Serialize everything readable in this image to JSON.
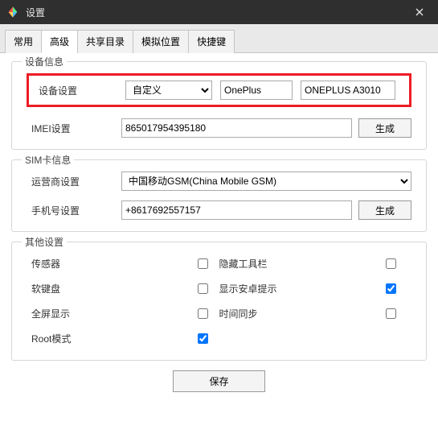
{
  "titlebar": {
    "title": "设置"
  },
  "tabs": [
    "常用",
    "高级",
    "共享目录",
    "模拟位置",
    "快捷键"
  ],
  "activeTab": 1,
  "deviceInfo": {
    "title": "设备信息",
    "deviceLabel": "设备设置",
    "deviceMode": "自定义",
    "brand": "OnePlus",
    "model": "ONEPLUS A3010",
    "imeiLabel": "IMEI设置",
    "imei": "865017954395180",
    "genBtn": "生成"
  },
  "simInfo": {
    "title": "SIM卡信息",
    "carrierLabel": "运营商设置",
    "carrier": "中国移动GSM(China Mobile GSM)",
    "phoneLabel": "手机号设置",
    "phone": "+8617692557157",
    "genBtn": "生成"
  },
  "other": {
    "title": "其他设置",
    "items": [
      {
        "label": "传感器",
        "checked": false
      },
      {
        "label": "隐藏工具栏",
        "checked": false
      },
      {
        "label": "软键盘",
        "checked": false
      },
      {
        "label": "显示安卓提示",
        "checked": true
      },
      {
        "label": "全屏显示",
        "checked": false
      },
      {
        "label": "时间同步",
        "checked": false
      },
      {
        "label": "Root模式",
        "checked": true
      }
    ]
  },
  "saveBtn": "保存"
}
